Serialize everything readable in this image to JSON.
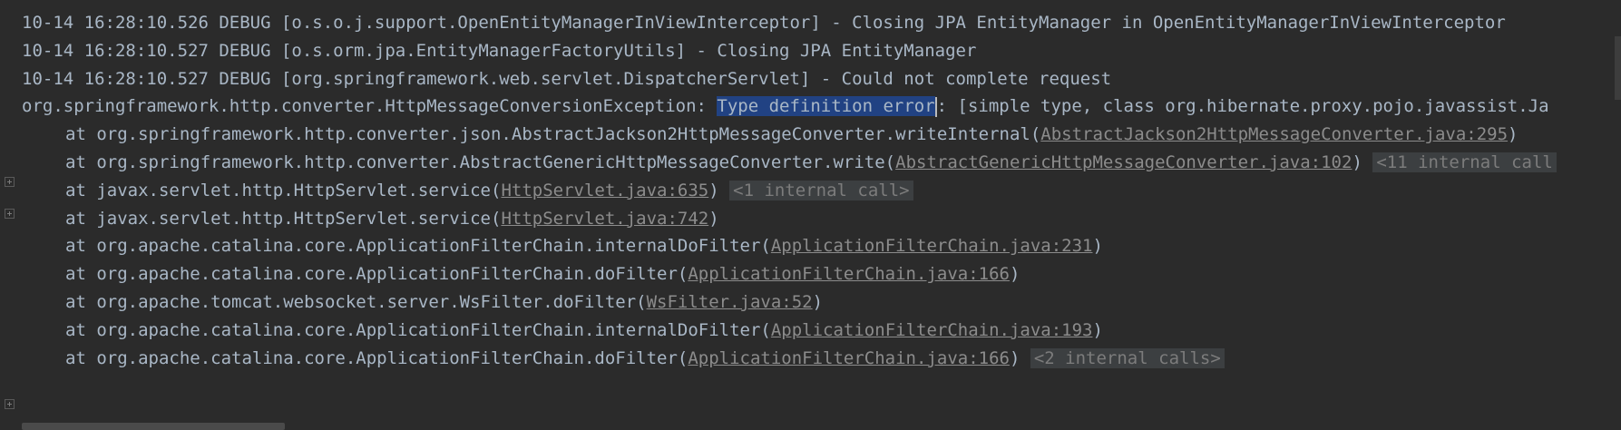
{
  "lines": [
    {
      "type": "log",
      "text": "10-14 16:28:10.526 DEBUG [o.s.o.j.support.OpenEntityManagerInViewInterceptor] - Closing JPA EntityManager in OpenEntityManagerInViewInterceptor"
    },
    {
      "type": "log",
      "text": "10-14 16:28:10.527 DEBUG [o.s.orm.jpa.EntityManagerFactoryUtils] - Closing JPA EntityManager"
    },
    {
      "type": "log",
      "text": "10-14 16:28:10.527 DEBUG [org.springframework.web.servlet.DispatcherServlet] - Could not complete request"
    },
    {
      "type": "exception",
      "pre": "org.springframework.http.converter.HttpMessageConversionException: ",
      "selected": "Type definition error",
      "post": ": [simple type, class org.hibernate.proxy.pojo.javassist.Ja"
    },
    {
      "type": "frame",
      "pre": "at org.springframework.http.converter.json.AbstractJackson2HttpMessageConverter.writeInternal(",
      "link": "AbstractJackson2HttpMessageConverter.java:295",
      "post": ")",
      "chip": ""
    },
    {
      "type": "frame",
      "pre": "at org.springframework.http.converter.AbstractGenericHttpMessageConverter.write(",
      "link": "AbstractGenericHttpMessageConverter.java:102",
      "post": ")",
      "chip": "<11 internal call"
    },
    {
      "type": "frame",
      "pre": "at javax.servlet.http.HttpServlet.service(",
      "link": "HttpServlet.java:635",
      "post": ")",
      "chip": "<1 internal call>"
    },
    {
      "type": "frame",
      "pre": "at javax.servlet.http.HttpServlet.service(",
      "link": "HttpServlet.java:742",
      "post": ")",
      "chip": ""
    },
    {
      "type": "frame",
      "pre": "at org.apache.catalina.core.ApplicationFilterChain.internalDoFilter(",
      "link": "ApplicationFilterChain.java:231",
      "post": ")",
      "chip": ""
    },
    {
      "type": "frame",
      "pre": "at org.apache.catalina.core.ApplicationFilterChain.doFilter(",
      "link": "ApplicationFilterChain.java:166",
      "post": ")",
      "chip": ""
    },
    {
      "type": "frame",
      "pre": "at org.apache.tomcat.websocket.server.WsFilter.doFilter(",
      "link": "WsFilter.java:52",
      "post": ")",
      "chip": ""
    },
    {
      "type": "frame",
      "pre": "at org.apache.catalina.core.ApplicationFilterChain.internalDoFilter(",
      "link": "ApplicationFilterChain.java:193",
      "post": ")",
      "chip": ""
    },
    {
      "type": "frame",
      "pre": "at org.apache.catalina.core.ApplicationFilterChain.doFilter(",
      "link": "ApplicationFilterChain.java:166",
      "post": ")",
      "chip": "<2 internal calls>"
    }
  ],
  "fold_icons": [
    "expand-icon",
    "expand-icon",
    "expand-icon"
  ],
  "colors": {
    "background": "#2b2b2b",
    "text": "#a9b7c6",
    "link": "#8c8c8c",
    "selection": "#214283",
    "chip_bg": "#3c3f41"
  }
}
